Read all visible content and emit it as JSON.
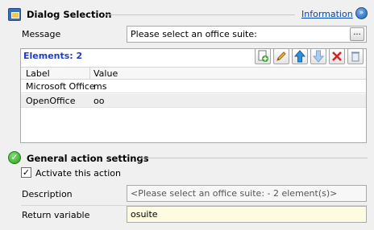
{
  "dialog_section": {
    "title": "Dialog Selection",
    "info_link": "Information"
  },
  "message": {
    "label": "Message",
    "value": "Please select an office suite:",
    "browse_button": "..."
  },
  "elements": {
    "title": "Elements: 2",
    "toolbar": {
      "add": "add-item",
      "edit": "edit-item",
      "move_up": "move-up",
      "move_down": "move-down",
      "delete": "delete",
      "clear": "clear"
    },
    "columns": [
      "Label",
      "Value"
    ],
    "rows": [
      {
        "label": "Microsoft Office",
        "value": "ms"
      },
      {
        "label": "OpenOffice",
        "value": "oo"
      }
    ]
  },
  "general_settings": {
    "title": "General action settings",
    "activate_label": "Activate this action",
    "activate_checked": true,
    "description_label": "Description",
    "description_value": "<Please select an office suite: - 2 element(s)>",
    "return_variable_label": "Return variable",
    "return_variable_value": "osuite"
  }
}
